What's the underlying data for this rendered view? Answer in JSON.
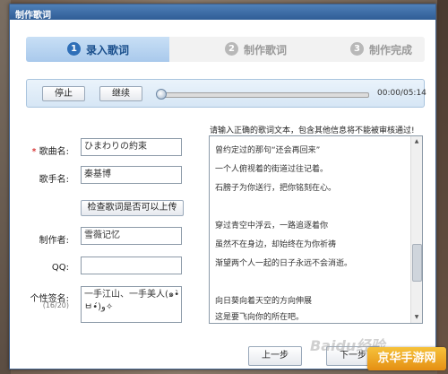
{
  "window": {
    "title": "制作歌词"
  },
  "steps": [
    {
      "num": "1",
      "label": "录入歌词",
      "state": "active"
    },
    {
      "num": "2",
      "label": "制作歌词",
      "state": "inactive"
    },
    {
      "num": "3",
      "label": "制作完成",
      "state": "inactive"
    }
  ],
  "player": {
    "stop_label": "停止",
    "continue_label": "继续",
    "time": "00:00/05:14",
    "progress": 0.0
  },
  "form": {
    "song_label": "歌曲名:",
    "song_required_mark": "*",
    "song_value": "ひまわりの約束",
    "singer_label": "歌手名:",
    "singer_value": "秦基博",
    "check_button": "检查歌词是否可以上传",
    "maker_label": "制作者:",
    "maker_value": "雪薇记忆",
    "qq_label": "QQ:",
    "qq_value": "",
    "signature_label": "个性签名:",
    "signature_count": "(16/20)",
    "signature_value": "一手江山、一手美人(๑•̀ㅂ•́)و✧"
  },
  "lyrics": {
    "hint": "请输入正确的歌词文本，包含其他信息将不能被审核通过!",
    "lines": [
      "曾约定过的那句“还会再回来”",
      "一个人俯视着的街道过往记着。",
      "石膀子为你送行，把你铭刻在心。",
      "",
      "穿过青空中浮云，一路追逐着你",
      "虽然不在身边，却始终在为你祈祷",
      "渐望两个人一起的日子永远不会消逝。",
      "",
      "向日葵向着天空的方向伸展",
      "这是要飞向你的所在吧。"
    ]
  },
  "footer": {
    "prev_label": "上一步",
    "next_label": "下一步"
  },
  "overlay": {
    "watermark": "Baidu经验",
    "brand": "京华手游网"
  },
  "colors": {
    "accent": "#2f6fb8",
    "titlebar": "#2f5d96",
    "required": "#cc0000",
    "brand": "#e58f13"
  }
}
